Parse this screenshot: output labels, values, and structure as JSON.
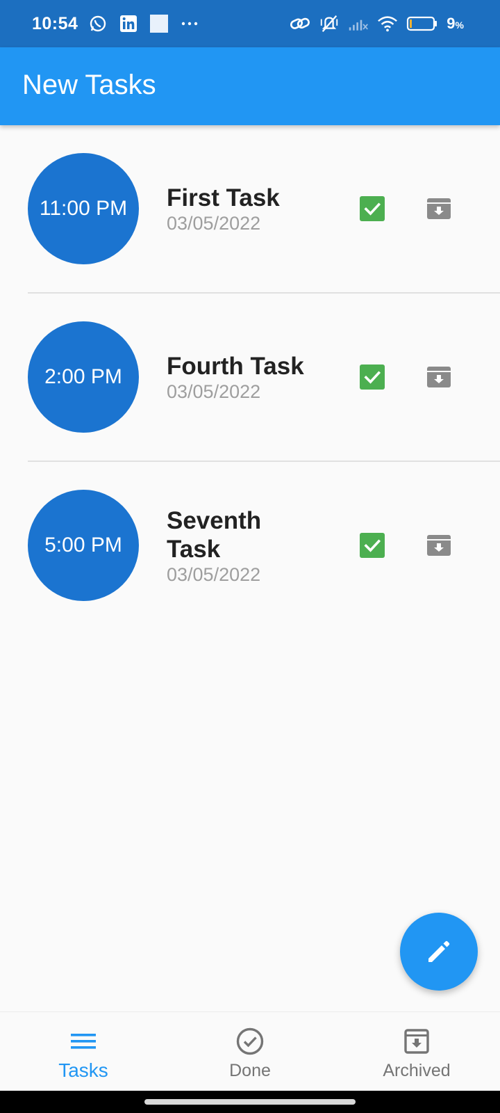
{
  "status_bar": {
    "time": "10:54",
    "battery_percent": "9",
    "battery_unit": "%",
    "left_icons": [
      "whatsapp-icon",
      "linkedin-icon",
      "square-notification-icon",
      "more-dots-icon"
    ],
    "right_icons": [
      "link-icon",
      "vibrate-off-icon",
      "cellular-signal-icon",
      "wifi-icon",
      "battery-icon"
    ]
  },
  "app_bar": {
    "title": "New Tasks"
  },
  "tasks": [
    {
      "time": "11:00 PM",
      "title": "First Task",
      "date": "03/05/2022"
    },
    {
      "time": "2:00 PM",
      "title": "Fourth Task",
      "date": "03/05/2022"
    },
    {
      "time": "5:00 PM",
      "title": "Seventh Task",
      "date": "03/05/2022"
    }
  ],
  "fab": {
    "icon": "edit-icon"
  },
  "bottom_nav": {
    "items": [
      {
        "label": "Tasks",
        "icon": "menu-icon",
        "active": true
      },
      {
        "label": "Done",
        "icon": "check-circle-icon",
        "active": false
      },
      {
        "label": "Archived",
        "icon": "archive-icon",
        "active": false
      }
    ]
  },
  "colors": {
    "status_bar": "#1c6fc0",
    "app_bar": "#2196f3",
    "time_circle": "#1b74d0",
    "done_green": "#4caf50",
    "archive_grey": "#8a8a8a",
    "active_nav": "#2196f3"
  }
}
